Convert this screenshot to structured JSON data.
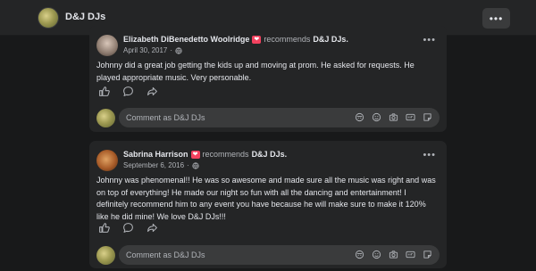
{
  "header": {
    "page_name": "D&J DJs",
    "more_label": "•••"
  },
  "reviews": [
    {
      "author": "Elizabeth DiBenedetto Woolridge",
      "recommends": "recommends",
      "target": "D&J DJs.",
      "date": "April 30, 2017",
      "text": "Johnny did a great job getting the kids up and moving at prom. He asked for requests. He played appropriate music. Very personable.",
      "more": "•••",
      "comment_placeholder": "Comment as D&J DJs"
    },
    {
      "author": "Sabrina Harrison",
      "recommends": "recommends",
      "target": "D&J DJs.",
      "date": "September 6, 2016",
      "text": "Johnny was phenomenal!! He was so awesome and made sure all the music was right and was on top of everything! He made our night so fun with all the dancing and entertainment! I definitely recommend him to any event you have because he will make sure to make it 120% like he did mine! We love D&J DJs!!!",
      "more": "•••",
      "comment_placeholder": "Comment as D&J DJs"
    }
  ],
  "icons": {
    "action_icons": [
      "like-icon",
      "comment-icon",
      "share-icon"
    ],
    "comment_tool_icons": [
      "avatar-sticker-icon",
      "emoji-icon",
      "camera-icon",
      "gif-icon",
      "sticker-icon"
    ]
  },
  "colors": {
    "background": "#18191a",
    "card": "#242526",
    "input": "#3a3b3c",
    "recommend_badge": "#f3425f"
  }
}
